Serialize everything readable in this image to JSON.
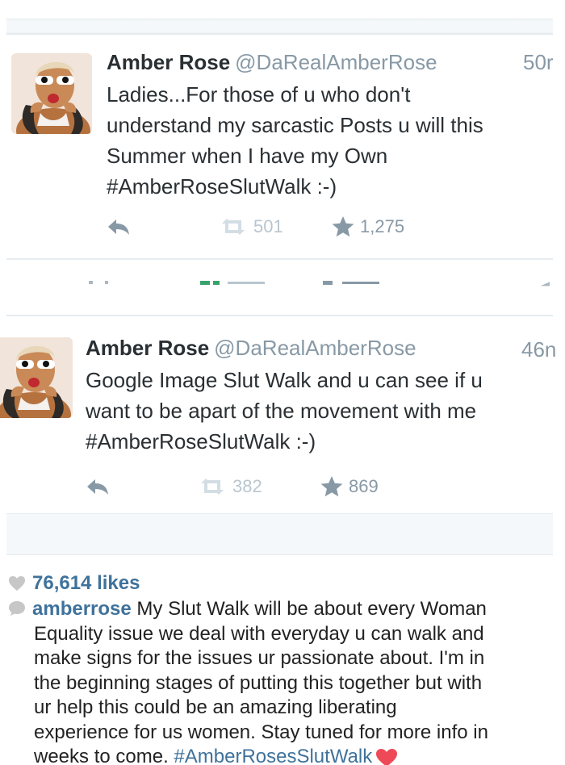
{
  "tweets": [
    {
      "name": "Amber Rose",
      "handle": "@DaRealAmberRose",
      "time": "50r",
      "lines": [
        "Ladies...For those of u who don't",
        "understand my sarcastic Posts u will this",
        "Summer when I have my Own",
        "#AmberRoseSlutWalk :-)"
      ],
      "retweets": "501",
      "favorites": "1,275"
    },
    {
      "name": "Amber Rose",
      "handle": "@DaRealAmberRose",
      "time": "46n",
      "lines": [
        "Google Image Slut Walk and u can see if u",
        "want to be apart of the movement with me",
        "#AmberRoseSlutWalk :-)"
      ],
      "retweets": "382",
      "favorites": "869"
    }
  ],
  "post": {
    "likes": "76,614 likes",
    "username": "amberrose",
    "caption_lines": [
      " My Slut Walk will be about every Woman",
      "Equality issue we deal with everyday u can walk and",
      "make signs for the issues ur passionate about. I'm in",
      "the beginning stages of putting this together but with",
      "ur help this could be an amazing liberating",
      "experience for us women. Stay tuned for more info in",
      "weeks to come. "
    ],
    "hashtag": "#AmberRosesSlutWalk"
  },
  "colors": {
    "twitter_text": "#292f33",
    "twitter_muted": "#8899a6",
    "instagram_blue": "#3f729b",
    "heart_red": "#ed4956"
  }
}
